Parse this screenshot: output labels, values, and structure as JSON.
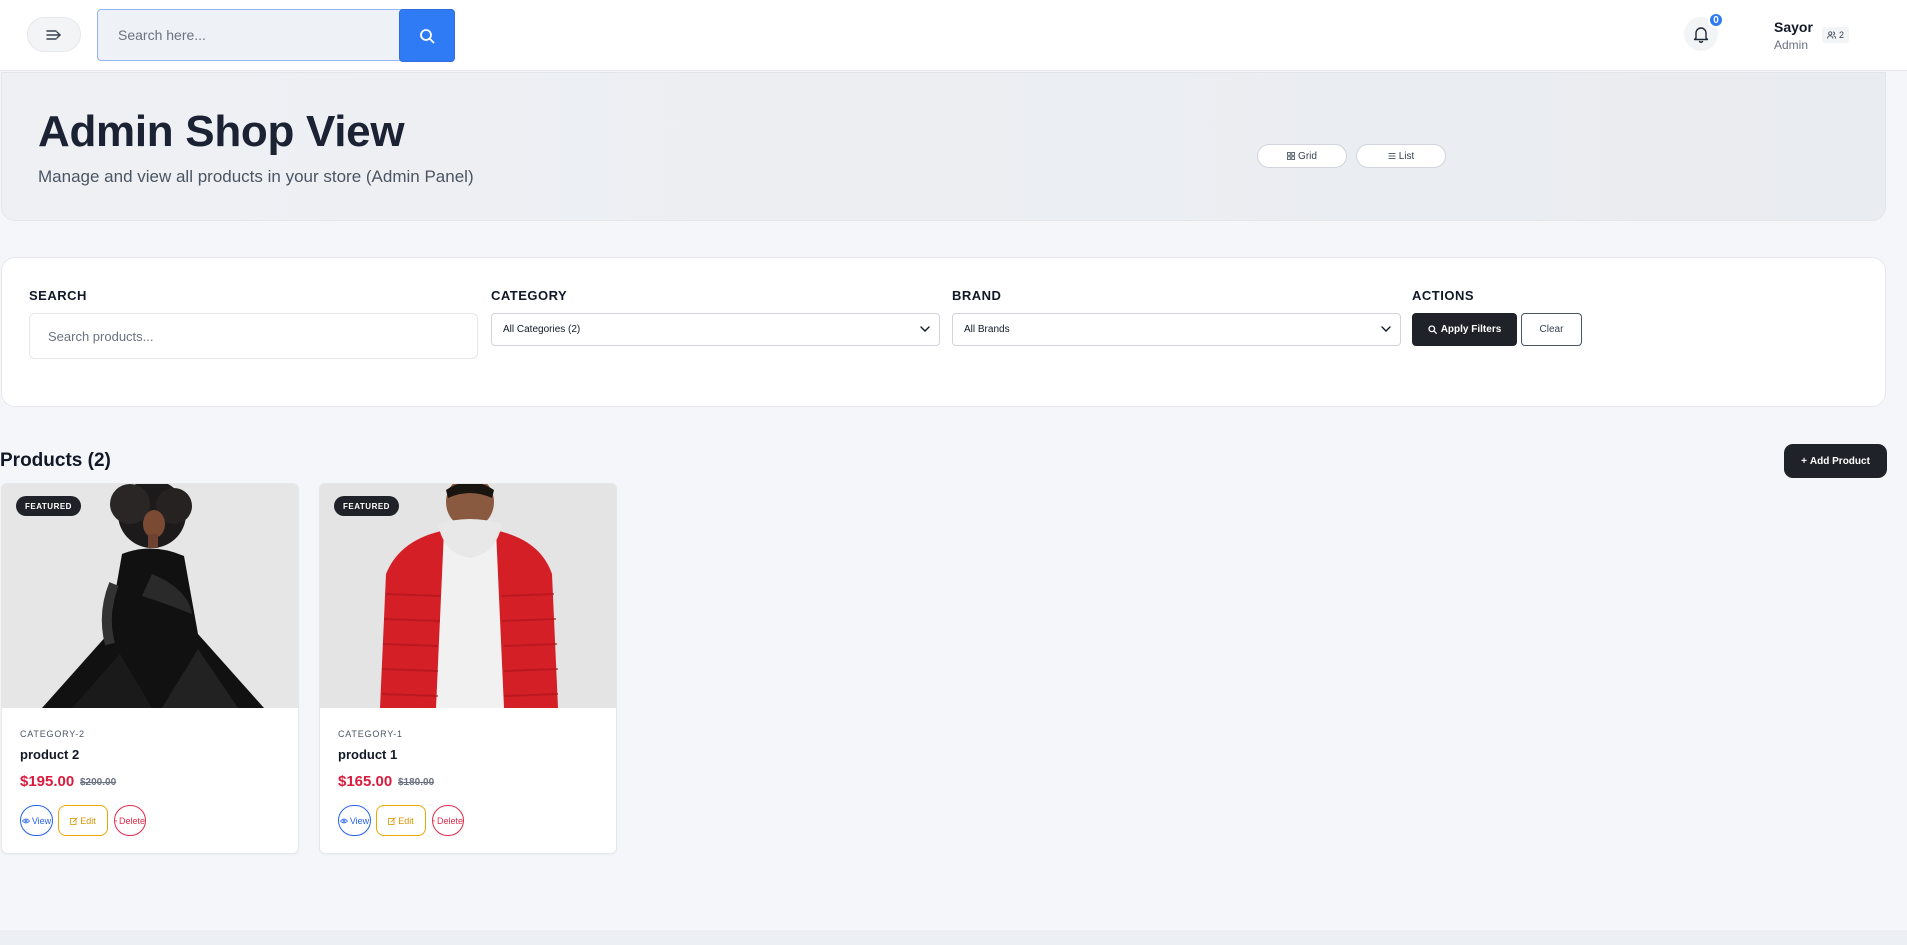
{
  "topbar": {
    "search_placeholder": "Search here...",
    "notification_count": "0",
    "user_name": "Sayor",
    "user_role": "Admin",
    "user_chip": "2"
  },
  "hero": {
    "title": "Admin Shop View",
    "subtitle": "Manage and view all products in your store (Admin Panel)",
    "grid_label": "Grid",
    "list_label": "List"
  },
  "filters": {
    "search_label": "SEARCH",
    "search_placeholder": "Search products...",
    "category_label": "CATEGORY",
    "category_value": "All Categories (2)",
    "brand_label": "BRAND",
    "brand_value": "All Brands",
    "actions_label": "ACTIONS",
    "apply_label": "Apply Filters",
    "clear_label": "Clear"
  },
  "products": {
    "title": "Products (2)",
    "add_label": "Add Product",
    "items": [
      {
        "badge": "FEATURED",
        "category": "CATEGORY-2",
        "name": "product 2",
        "price": "$195.00",
        "old_price": "$200.00",
        "view": "View",
        "edit": "Edit",
        "delete": "Delete"
      },
      {
        "badge": "FEATURED",
        "category": "CATEGORY-1",
        "name": "product 1",
        "price": "$165.00",
        "old_price": "$180.00",
        "view": "View",
        "edit": "Edit",
        "delete": "Delete"
      }
    ]
  },
  "colors": {
    "primary": "#2f7bf5",
    "dark": "#1f2329",
    "price": "#d81b3c",
    "edit": "#f0a500",
    "delete": "#dc2d4a"
  }
}
